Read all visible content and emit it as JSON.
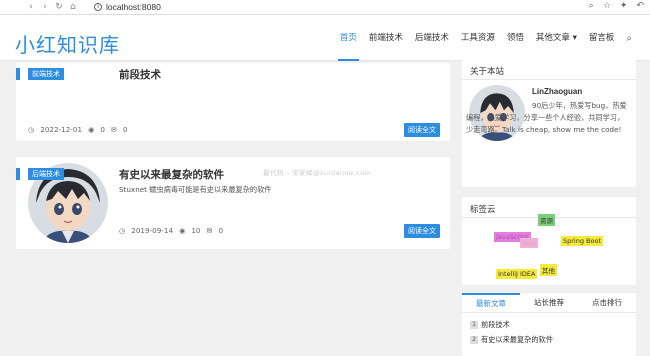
{
  "browser": {
    "url": "localhost:8080"
  },
  "header": {
    "logo": "小红知识库",
    "menu": [
      {
        "label": "首页",
        "active": true
      },
      {
        "label": "前端技术"
      },
      {
        "label": "后端技术"
      },
      {
        "label": "工具资源"
      },
      {
        "label": "领悟"
      },
      {
        "label": "其他文章 ▾"
      },
      {
        "label": "留言板"
      }
    ]
  },
  "posts": [
    {
      "tag": "前端技术",
      "title": "前段技术",
      "description": "",
      "date": "2022-12-01",
      "views": "0",
      "comments": "0",
      "read_label": "阅读全文"
    },
    {
      "tag": "后端技术",
      "title": "有史以来最复杂的软件",
      "description": "Stuxnet 蠕虫病毒可能是有史以来最复杂的软件",
      "date": "2019-09-14",
      "views": "10",
      "comments": "0",
      "read_label": "阅读全文"
    }
  ],
  "watermark": "最代码 - 宋家辉@zuidaima.com",
  "about": {
    "title": "关于本站",
    "name": "LinZhaoguan",
    "bio": "90后少年，热爱写bug，热爱编程，热爱学习，分享一些个人经验，共同学习，少走弯路。Talk is cheap, show me the code!"
  },
  "tagcloud": {
    "title": "标签云",
    "tags": [
      {
        "label": "资源",
        "color": "#7ad07a"
      },
      {
        "label": "JavaScript",
        "color": "#e37de0"
      },
      {
        "label": "Spring Boot",
        "color": "#f4ea3a"
      },
      {
        "label": "Java",
        "color": "#f0b0d8"
      },
      {
        "label": "其他",
        "color": "#f4ea3a"
      },
      {
        "label": "IntelliJ IDEA",
        "color": "#f4ea3a"
      }
    ]
  },
  "ranking": {
    "tabs": [
      "最新文章",
      "站长推荐",
      "点击排行"
    ],
    "items": [
      "前段技术",
      "有史以来最复杂的软件"
    ]
  }
}
